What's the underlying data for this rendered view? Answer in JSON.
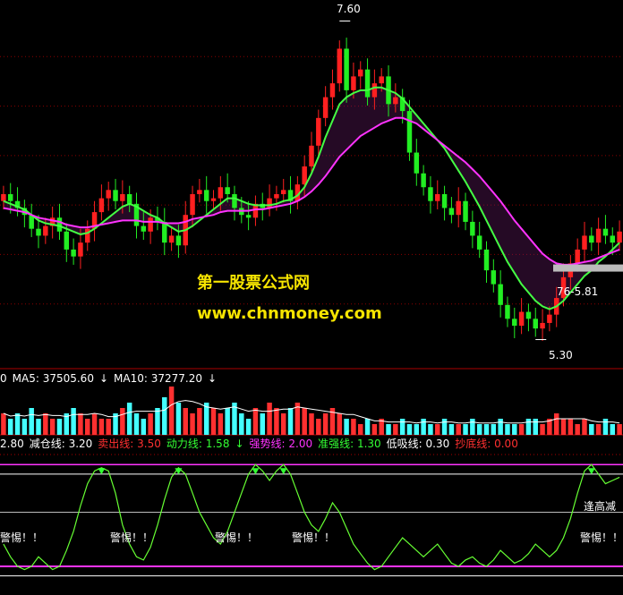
{
  "watermark": {
    "line1": "第一股票公式网",
    "line2": "www.chnmoney.com"
  },
  "price_labels": {
    "high": "7.60",
    "low": "5.30",
    "last": "76-5.81"
  },
  "volume_legend": [
    {
      "text": "0",
      "color": "#ffffff"
    },
    {
      "text": "MA5: 37505.60",
      "color": "#ffffff"
    },
    {
      "text": "↓",
      "color": "#ffffff"
    },
    {
      "text": "MA10: 37277.20",
      "color": "#ffffff"
    },
    {
      "text": "↓",
      "color": "#ffffff"
    }
  ],
  "indicator_legend": [
    {
      "text": "2.80",
      "color": "#ffffff"
    },
    {
      "text": "减仓线: 3.20",
      "color": "#ffffff"
    },
    {
      "text": "卖出线: 3.50",
      "color": "#ff3030"
    },
    {
      "text": "动力线: 1.58",
      "color": "#33ff33"
    },
    {
      "text": "↓",
      "color": "#33ff33"
    },
    {
      "text": "强势线: 2.00",
      "color": "#ff33ff"
    },
    {
      "text": "准强线: 1.30",
      "color": "#33ff33"
    },
    {
      "text": "低吸线: 0.30",
      "color": "#ffffff"
    },
    {
      "text": "抄底线: 0.00",
      "color": "#ff3030"
    }
  ],
  "warnings": {
    "label": "警惕！！",
    "top_right": "逢高减"
  },
  "colors": {
    "up": "#ff2020",
    "down": "#22ee22",
    "ma_slow": "#ff33ff",
    "ma_fast": "#44ff44",
    "volume_up": "#ff3030",
    "volume_down": "#44ffff"
  },
  "chart_data": {
    "type": "candlestick",
    "price_range": [
      5.2,
      7.7
    ],
    "high_marker": 7.6,
    "low_marker": 5.3,
    "last_marker": 5.81,
    "closes": [
      6.35,
      6.3,
      6.25,
      6.2,
      6.1,
      6.05,
      6.12,
      6.18,
      6.08,
      5.95,
      5.9,
      6.0,
      6.1,
      6.22,
      6.32,
      6.38,
      6.3,
      6.35,
      6.28,
      6.12,
      6.08,
      6.18,
      6.15,
      6.0,
      6.05,
      5.98,
      6.2,
      6.35,
      6.38,
      6.3,
      6.32,
      6.4,
      6.35,
      6.25,
      6.2,
      6.18,
      6.28,
      6.25,
      6.32,
      6.35,
      6.38,
      6.3,
      6.42,
      6.55,
      6.7,
      6.9,
      7.05,
      7.15,
      7.4,
      7.1,
      7.2,
      7.25,
      7.05,
      7.15,
      7.2,
      7.0,
      7.05,
      6.95,
      6.65,
      6.5,
      6.4,
      6.3,
      6.35,
      6.25,
      6.2,
      6.3,
      6.15,
      6.05,
      5.95,
      5.8,
      5.7,
      5.55,
      5.45,
      5.4,
      5.5,
      5.45,
      5.38,
      5.42,
      5.48,
      5.6,
      5.75,
      5.85,
      5.95,
      6.05,
      6.0,
      6.1,
      6.05,
      6.0,
      6.08
    ],
    "ma_slow": [
      6.25,
      6.24,
      6.23,
      6.22,
      6.2,
      6.18,
      6.17,
      6.16,
      6.15,
      6.13,
      6.12,
      6.11,
      6.11,
      6.12,
      6.13,
      6.14,
      6.15,
      6.16,
      6.16,
      6.16,
      6.15,
      6.15,
      6.15,
      6.14,
      6.14,
      6.14,
      6.15,
      6.17,
      6.18,
      6.19,
      6.2,
      6.22,
      6.23,
      6.23,
      6.23,
      6.23,
      6.24,
      6.24,
      6.25,
      6.26,
      6.27,
      6.28,
      6.3,
      6.33,
      6.37,
      6.42,
      6.48,
      6.55,
      6.62,
      6.67,
      6.72,
      6.77,
      6.8,
      6.83,
      6.86,
      6.88,
      6.9,
      6.9,
      6.88,
      6.86,
      6.82,
      6.78,
      6.74,
      6.7,
      6.66,
      6.62,
      6.58,
      6.53,
      6.48,
      6.42,
      6.36,
      6.3,
      6.23,
      6.16,
      6.1,
      6.04,
      5.98,
      5.92,
      5.88,
      5.85,
      5.84,
      5.84,
      5.85,
      5.86,
      5.87,
      5.89,
      5.91,
      5.93,
      5.95
    ],
    "ma_fast": [
      6.3,
      6.28,
      6.26,
      6.24,
      6.2,
      6.16,
      6.14,
      6.13,
      6.12,
      6.1,
      6.08,
      6.06,
      6.07,
      6.1,
      6.14,
      6.18,
      6.22,
      6.26,
      6.28,
      6.26,
      6.23,
      6.2,
      6.18,
      6.14,
      6.11,
      6.08,
      6.09,
      6.12,
      6.16,
      6.2,
      6.24,
      6.28,
      6.32,
      6.32,
      6.3,
      6.28,
      6.27,
      6.27,
      6.27,
      6.28,
      6.3,
      6.31,
      6.34,
      6.4,
      6.5,
      6.62,
      6.76,
      6.88,
      7.0,
      7.05,
      7.08,
      7.1,
      7.1,
      7.12,
      7.12,
      7.1,
      7.08,
      7.04,
      6.98,
      6.92,
      6.86,
      6.8,
      6.74,
      6.68,
      6.6,
      6.52,
      6.44,
      6.35,
      6.26,
      6.16,
      6.06,
      5.96,
      5.86,
      5.78,
      5.7,
      5.64,
      5.58,
      5.54,
      5.52,
      5.54,
      5.58,
      5.64,
      5.7,
      5.76,
      5.8,
      5.86,
      5.9,
      5.95,
      6.0
    ],
    "volume": [
      4,
      3,
      4,
      3,
      5,
      3,
      4,
      3,
      3,
      4,
      5,
      4,
      3,
      4,
      3,
      3,
      4,
      5,
      6,
      4,
      3,
      4,
      5,
      7,
      9,
      6,
      5,
      4,
      5,
      6,
      5,
      4,
      5,
      6,
      4,
      3,
      5,
      4,
      6,
      5,
      4,
      5,
      6,
      5,
      4,
      3,
      4,
      5,
      4,
      3,
      3,
      2,
      3,
      2,
      3,
      2,
      2,
      3,
      2,
      2,
      3,
      2,
      2,
      3,
      2,
      2,
      2,
      3,
      2,
      2,
      2,
      3,
      2,
      2,
      2,
      3,
      3,
      2,
      3,
      4,
      3,
      3,
      2,
      3,
      2,
      2,
      3,
      2,
      2
    ],
    "indicator": [
      1.0,
      0.6,
      0.3,
      0.2,
      0.3,
      0.6,
      0.4,
      0.2,
      0.3,
      0.8,
      1.4,
      2.2,
      2.9,
      3.3,
      3.4,
      3.3,
      2.6,
      1.6,
      1.0,
      0.6,
      0.5,
      0.9,
      1.6,
      2.4,
      3.1,
      3.4,
      3.2,
      2.6,
      2.0,
      1.6,
      1.2,
      1.0,
      1.4,
      2.0,
      2.6,
      3.2,
      3.5,
      3.3,
      3.0,
      3.3,
      3.5,
      3.2,
      2.6,
      2.0,
      1.6,
      1.4,
      1.8,
      2.3,
      2.0,
      1.5,
      1.0,
      0.7,
      0.4,
      0.2,
      0.3,
      0.6,
      0.9,
      1.2,
      1.0,
      0.8,
      0.6,
      0.8,
      1.0,
      0.7,
      0.4,
      0.3,
      0.5,
      0.6,
      0.4,
      0.3,
      0.5,
      0.8,
      0.6,
      0.4,
      0.5,
      0.7,
      1.0,
      0.8,
      0.6,
      0.8,
      1.2,
      1.8,
      2.6,
      3.3,
      3.5,
      3.2,
      2.9,
      3.0,
      3.1
    ],
    "indicator_levels": {
      "sell": 3.5,
      "reduce": 3.2,
      "strong": 2.0,
      "quasi_strong": 1.3,
      "buy_low": 0.3,
      "bottom": 0.0
    },
    "indicator_range": [
      -0.6,
      3.9
    ]
  }
}
